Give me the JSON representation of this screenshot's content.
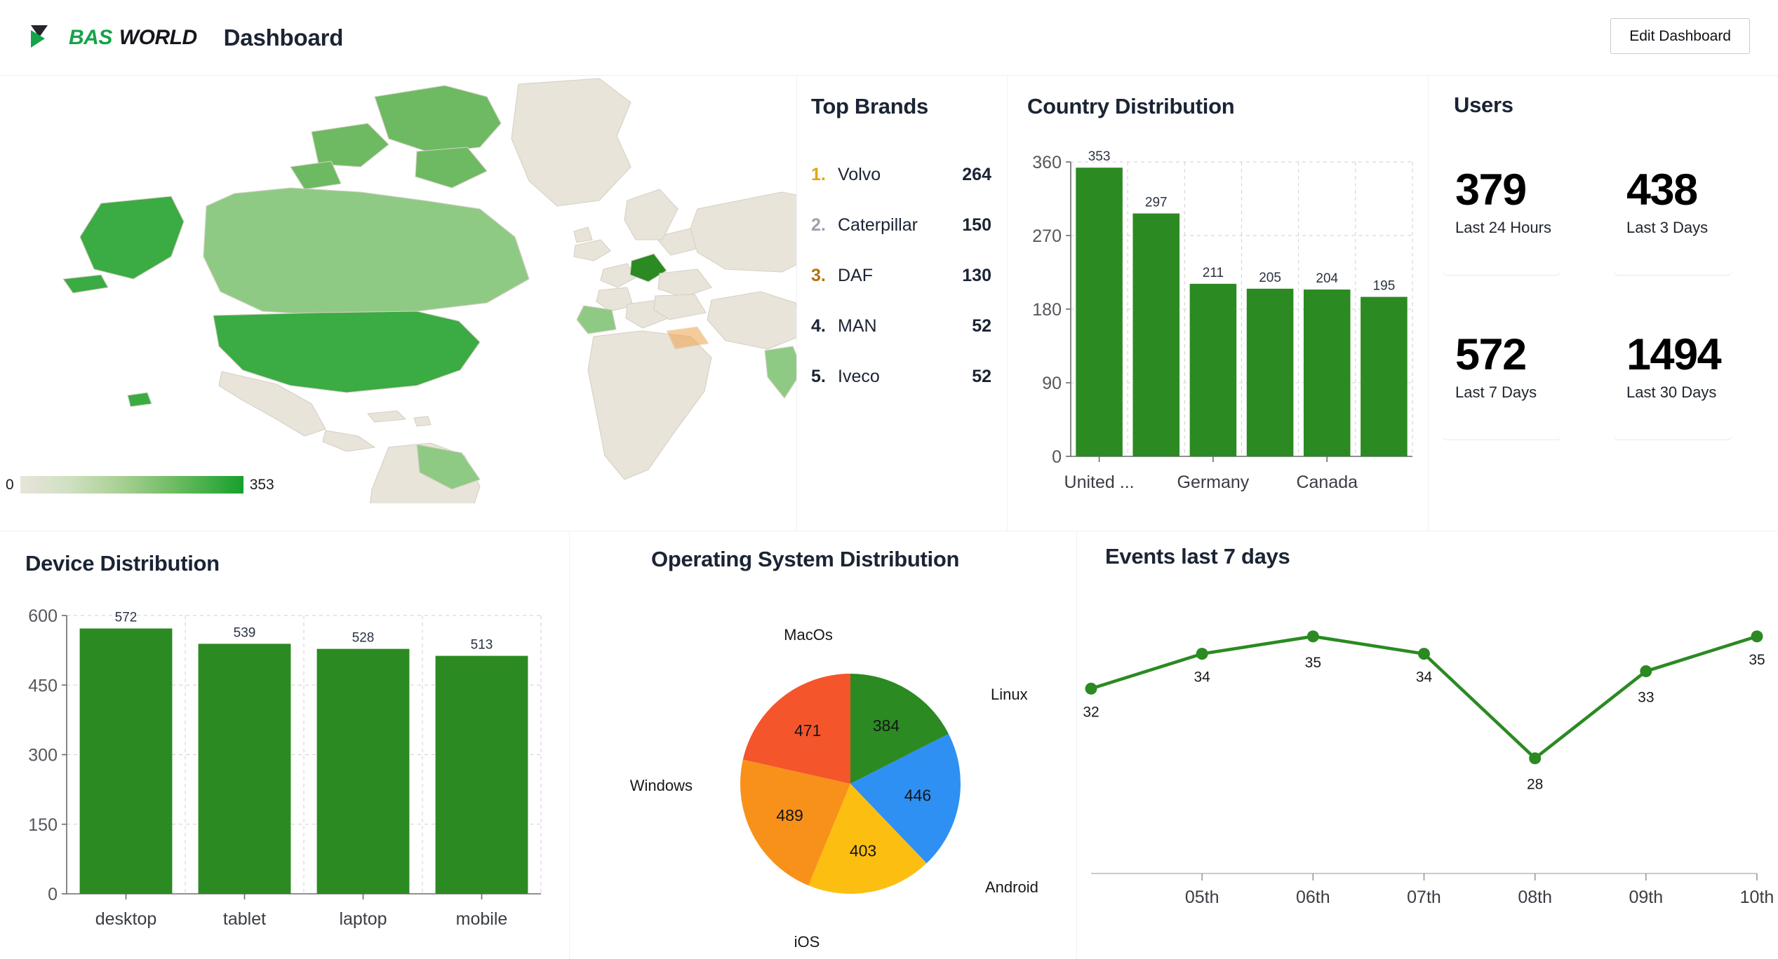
{
  "header": {
    "brand_primary": "BAS",
    "brand_secondary": "WORLD",
    "title": "Dashboard",
    "edit_button": "Edit Dashboard"
  },
  "map": {
    "legend_min": "0",
    "legend_max": "353",
    "low_color": "#e8e4da",
    "high_color": "#16a02c"
  },
  "brands": {
    "title": "Top Brands",
    "items": [
      {
        "rank": "1.",
        "name": "Volvo",
        "count": "264",
        "rank_color": "#e3a507"
      },
      {
        "rank": "2.",
        "name": "Caterpillar",
        "count": "150",
        "rank_color": "#9aa2ad"
      },
      {
        "rank": "3.",
        "name": "DAF",
        "count": "130",
        "rank_color": "#b5700b"
      },
      {
        "rank": "4.",
        "name": "MAN",
        "count": "52",
        "rank_color": "#1b2434"
      },
      {
        "rank": "5.",
        "name": "Iveco",
        "count": "52",
        "rank_color": "#1b2434"
      }
    ]
  },
  "users": {
    "title": "Users",
    "stats": [
      {
        "value": "379",
        "label": "Last 24 Hours"
      },
      {
        "value": "438",
        "label": "Last 3 Days"
      },
      {
        "value": "572",
        "label": "Last 7 Days"
      },
      {
        "value": "1494",
        "label": "Last 30 Days"
      }
    ]
  },
  "chart_data": [
    {
      "id": "country",
      "type": "bar",
      "title": "Country Distribution",
      "categories": [
        "United ...",
        "",
        "Germany",
        "",
        "Canada",
        ""
      ],
      "values": [
        353,
        297,
        211,
        205,
        204,
        195
      ],
      "value_labels": [
        "353",
        "297",
        "211",
        "205",
        "204",
        "195"
      ],
      "visible_tick_labels": [
        "United ...",
        "Germany",
        "Canada"
      ],
      "yticks": [
        0,
        90,
        180,
        270,
        360
      ],
      "ytick_labels": [
        "0",
        "90",
        "180",
        "270",
        "360"
      ],
      "ylim": [
        0,
        360
      ],
      "xlabel": "",
      "ylabel": "",
      "grid": true,
      "bar_color": "#2b8a22"
    },
    {
      "id": "device",
      "type": "bar",
      "title": "Device Distribution",
      "categories": [
        "desktop",
        "tablet",
        "laptop",
        "mobile"
      ],
      "values": [
        572,
        539,
        528,
        513
      ],
      "value_labels": [
        "572",
        "539",
        "528",
        "513"
      ],
      "yticks": [
        0,
        150,
        300,
        450,
        600
      ],
      "ytick_labels": [
        "0",
        "150",
        "300",
        "450",
        "600"
      ],
      "ylim": [
        0,
        600
      ],
      "xlabel": "",
      "ylabel": "",
      "grid": true,
      "bar_color": "#2b8a22"
    },
    {
      "id": "os",
      "type": "pie",
      "title": "Operating System Distribution",
      "labels": [
        "Linux",
        "Android",
        "iOS",
        "Windows",
        "MacOs"
      ],
      "values": [
        384,
        446,
        403,
        489,
        471
      ],
      "colors": [
        "#2b8a22",
        "#2e90f2",
        "#fcbe11",
        "#f8911a",
        "#f4552b"
      ],
      "legend": "around-slices"
    },
    {
      "id": "events",
      "type": "line",
      "title": "Events last 7 days",
      "x": [
        "",
        "05th",
        "06th",
        "07th",
        "08th",
        "09th",
        "10th"
      ],
      "tick_labels": [
        "05th",
        "06th",
        "07th",
        "08th",
        "09th",
        "10th"
      ],
      "values": [
        32,
        34,
        35,
        34,
        28,
        33,
        35
      ],
      "value_labels": [
        "32",
        "34",
        "35",
        "34",
        "28",
        "33",
        "35"
      ],
      "xlabel": "",
      "ylabel": "",
      "line_color": "#2b8a22",
      "grid": false
    }
  ]
}
